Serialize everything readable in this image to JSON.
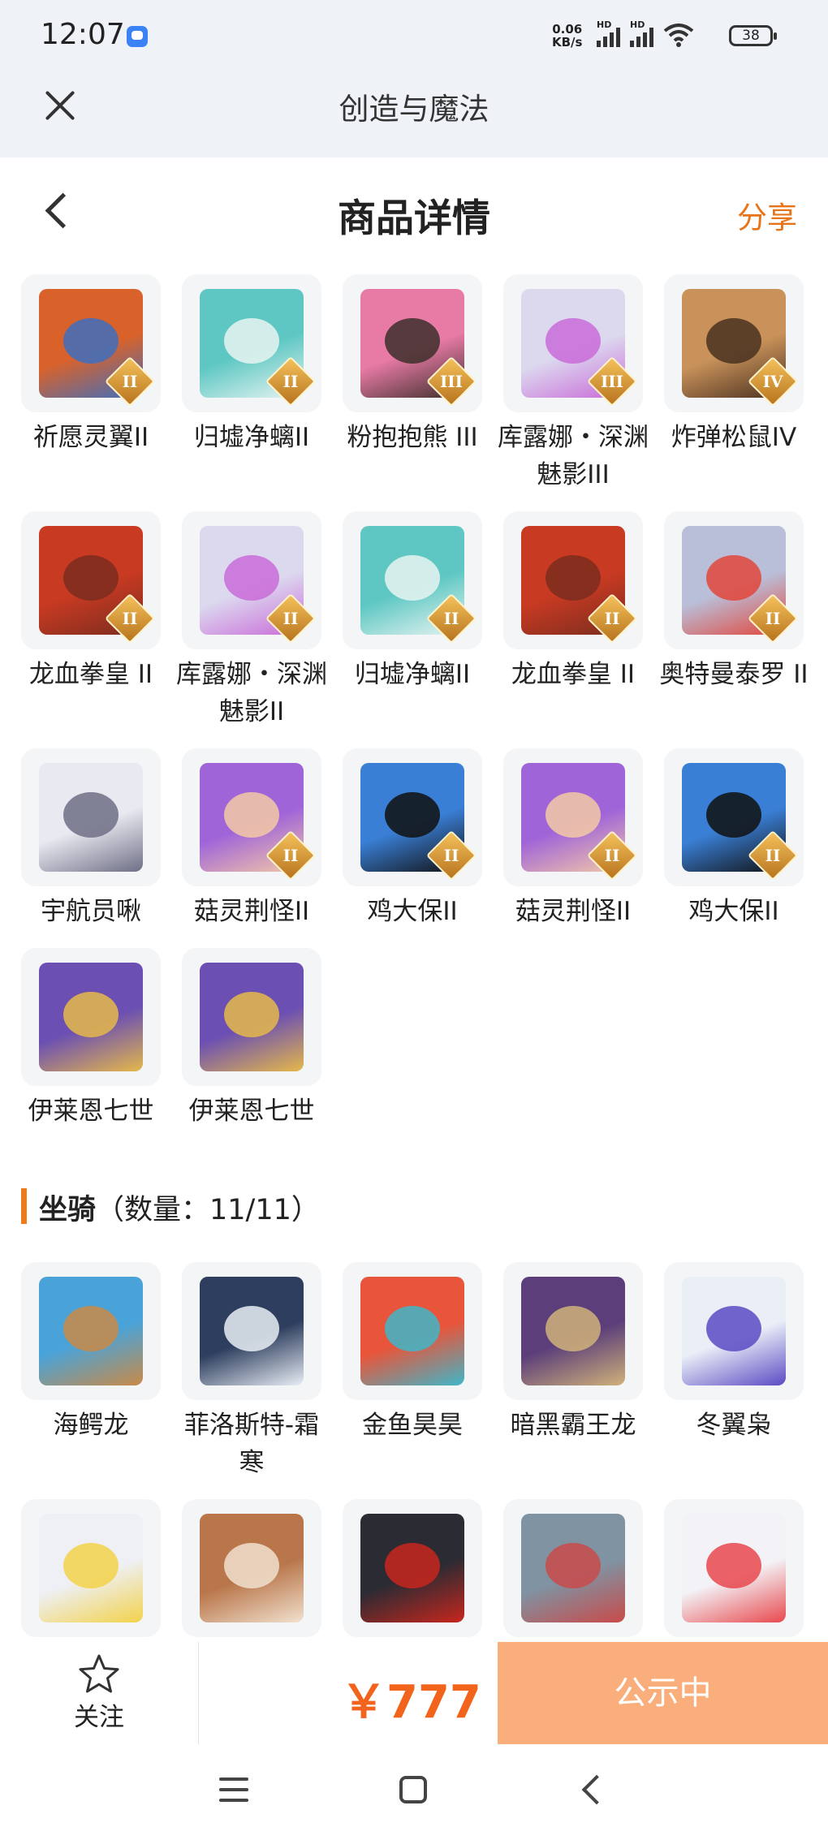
{
  "status_bar": {
    "time": "12:07",
    "net_speed_value": "0.06",
    "net_speed_unit": "KB/s",
    "battery": "38",
    "hd_label": "HD"
  },
  "header": {
    "title": "创造与魔法",
    "close_icon": "close-icon"
  },
  "page": {
    "title": "商品详情",
    "share_label": "分享"
  },
  "pets": [
    {
      "name": "祈愿灵翼II",
      "tier": "II",
      "color": "#d9622a",
      "accent": "#3d6fbf"
    },
    {
      "name": "归墟净螭II",
      "tier": "II",
      "color": "#5ec7c3",
      "accent": "#e7f4f1"
    },
    {
      "name": "粉抱抱熊 III",
      "tier": "III",
      "color": "#e87aa6",
      "accent": "#3d2f2a"
    },
    {
      "name": "库露娜・深渊魅影III",
      "tier": "III",
      "color": "#dcd9ef",
      "accent": "#c96bd8"
    },
    {
      "name": "炸弹松鼠IV",
      "tier": "IV",
      "color": "#c9925a",
      "accent": "#4a3120"
    },
    {
      "name": "龙血拳皇 II",
      "tier": "II",
      "color": "#c83a22",
      "accent": "#7b2d1f"
    },
    {
      "name": "库露娜・深渊魅影II",
      "tier": "II",
      "color": "#dcd9ef",
      "accent": "#c96bd8"
    },
    {
      "name": "归墟净螭II",
      "tier": "II",
      "color": "#5ec7c3",
      "accent": "#e7f4f1"
    },
    {
      "name": "龙血拳皇 II",
      "tier": "II",
      "color": "#c83a22",
      "accent": "#7b2d1f"
    },
    {
      "name": "奥特曼泰罗 II",
      "tier": "II",
      "color": "#b9bfd9",
      "accent": "#e2453a"
    },
    {
      "name": "宇航员啾",
      "tier": "",
      "color": "#e9e9f1",
      "accent": "#6f6f86"
    },
    {
      "name": "菇灵荆怪II",
      "tier": "II",
      "color": "#a064d9",
      "accent": "#f3c9a6"
    },
    {
      "name": "鸡大保II",
      "tier": "II",
      "color": "#3a7fd6",
      "accent": "#111111"
    },
    {
      "name": "菇灵荆怪II",
      "tier": "II",
      "color": "#a064d9",
      "accent": "#f3c9a6"
    },
    {
      "name": "鸡大保II",
      "tier": "II",
      "color": "#3a7fd6",
      "accent": "#111111"
    },
    {
      "name": "伊莱恩七世",
      "tier": "",
      "color": "#6b4fb3",
      "accent": "#e5b84a"
    },
    {
      "name": "伊莱恩七世",
      "tier": "",
      "color": "#6b4fb3",
      "accent": "#e5b84a"
    }
  ],
  "mounts_section": {
    "title": "坐骑",
    "count": "（数量：11/11）"
  },
  "mounts": [
    {
      "name": "海鳄龙",
      "color": "#4aa3d8",
      "accent": "#c98a47"
    },
    {
      "name": "菲洛斯特-霜寒",
      "color": "#2d3e5e",
      "accent": "#e9eef5"
    },
    {
      "name": "金鱼昊昊",
      "color": "#e8553a",
      "accent": "#3fb6c9"
    },
    {
      "name": "暗黑霸王龙",
      "color": "#5b3e7a",
      "accent": "#d0b27a"
    },
    {
      "name": "冬翼枭",
      "color": "#e9eef7",
      "accent": "#5b4bc4"
    },
    {
      "name": "",
      "color": "#eef0f6",
      "accent": "#f2d24a"
    },
    {
      "name": "",
      "color": "#b9764a",
      "accent": "#f1e1cf"
    },
    {
      "name": "",
      "color": "#2b2b33",
      "accent": "#c8261d"
    },
    {
      "name": "",
      "color": "#7f93a2",
      "accent": "#c94a4a"
    },
    {
      "name": "",
      "color": "#f3f3f7",
      "accent": "#e8484d"
    }
  ],
  "bottom_bar": {
    "follow_label": "关注",
    "price": "￥777",
    "status_label": "公示中"
  },
  "colors": {
    "accent": "#e8741a",
    "price": "#f2641c",
    "status_button": "#f9ae7c"
  }
}
